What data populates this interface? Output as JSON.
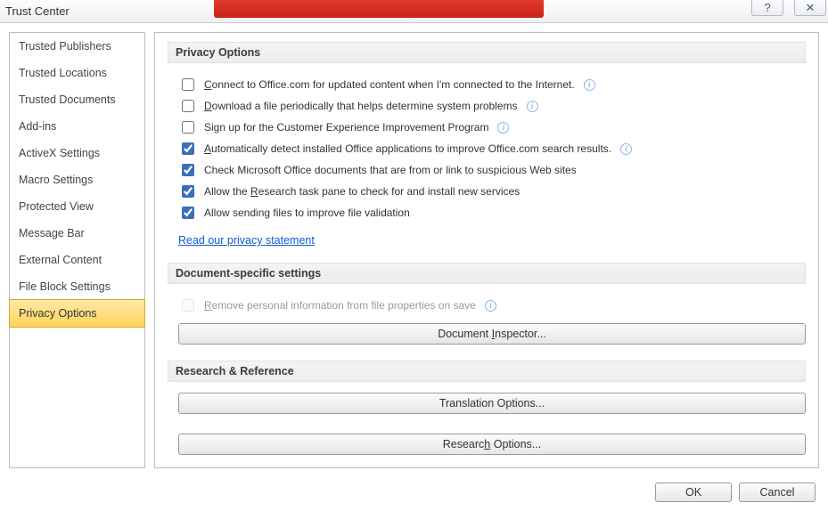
{
  "window": {
    "title": "Trust Center",
    "help_tooltip": "Help",
    "close_tooltip": "Close"
  },
  "sidebar": {
    "items": [
      {
        "label": "Trusted Publishers",
        "selected": false
      },
      {
        "label": "Trusted Locations",
        "selected": false
      },
      {
        "label": "Trusted Documents",
        "selected": false
      },
      {
        "label": "Add-ins",
        "selected": false
      },
      {
        "label": "ActiveX Settings",
        "selected": false
      },
      {
        "label": "Macro Settings",
        "selected": false
      },
      {
        "label": "Protected View",
        "selected": false
      },
      {
        "label": "Message Bar",
        "selected": false
      },
      {
        "label": "External Content",
        "selected": false
      },
      {
        "label": "File Block Settings",
        "selected": false
      },
      {
        "label": "Privacy Options",
        "selected": true
      }
    ]
  },
  "sections": {
    "privacy": {
      "header": "Privacy Options",
      "options": [
        {
          "checked": false,
          "label": "Connect to Office.com for updated content when I'm connected to the Internet.",
          "info": true
        },
        {
          "checked": false,
          "label": "Download a file periodically that helps determine system problems",
          "info": true
        },
        {
          "checked": false,
          "label": "Sign up for the Customer Experience Improvement Program",
          "info": true
        },
        {
          "checked": true,
          "label": "Automatically detect installed Office applications to improve Office.com search results.",
          "info": true
        },
        {
          "checked": true,
          "label": "Check Microsoft Office documents that are from or link to suspicious Web sites",
          "info": false
        },
        {
          "checked": true,
          "label": "Allow the Research task pane to check for and install new services",
          "info": false
        },
        {
          "checked": true,
          "label": "Allow sending files to improve file validation",
          "info": false
        }
      ],
      "link": "Read our privacy statement"
    },
    "document": {
      "header": "Document-specific settings",
      "remove_pii": {
        "checked": false,
        "disabled": true,
        "label": "Remove personal information from file properties on save",
        "info": true
      },
      "inspector_button": "Document Inspector..."
    },
    "research": {
      "header": "Research & Reference",
      "translation_button": "Translation Options...",
      "research_button": "Research Options..."
    }
  },
  "footer": {
    "ok": "OK",
    "cancel": "Cancel"
  }
}
